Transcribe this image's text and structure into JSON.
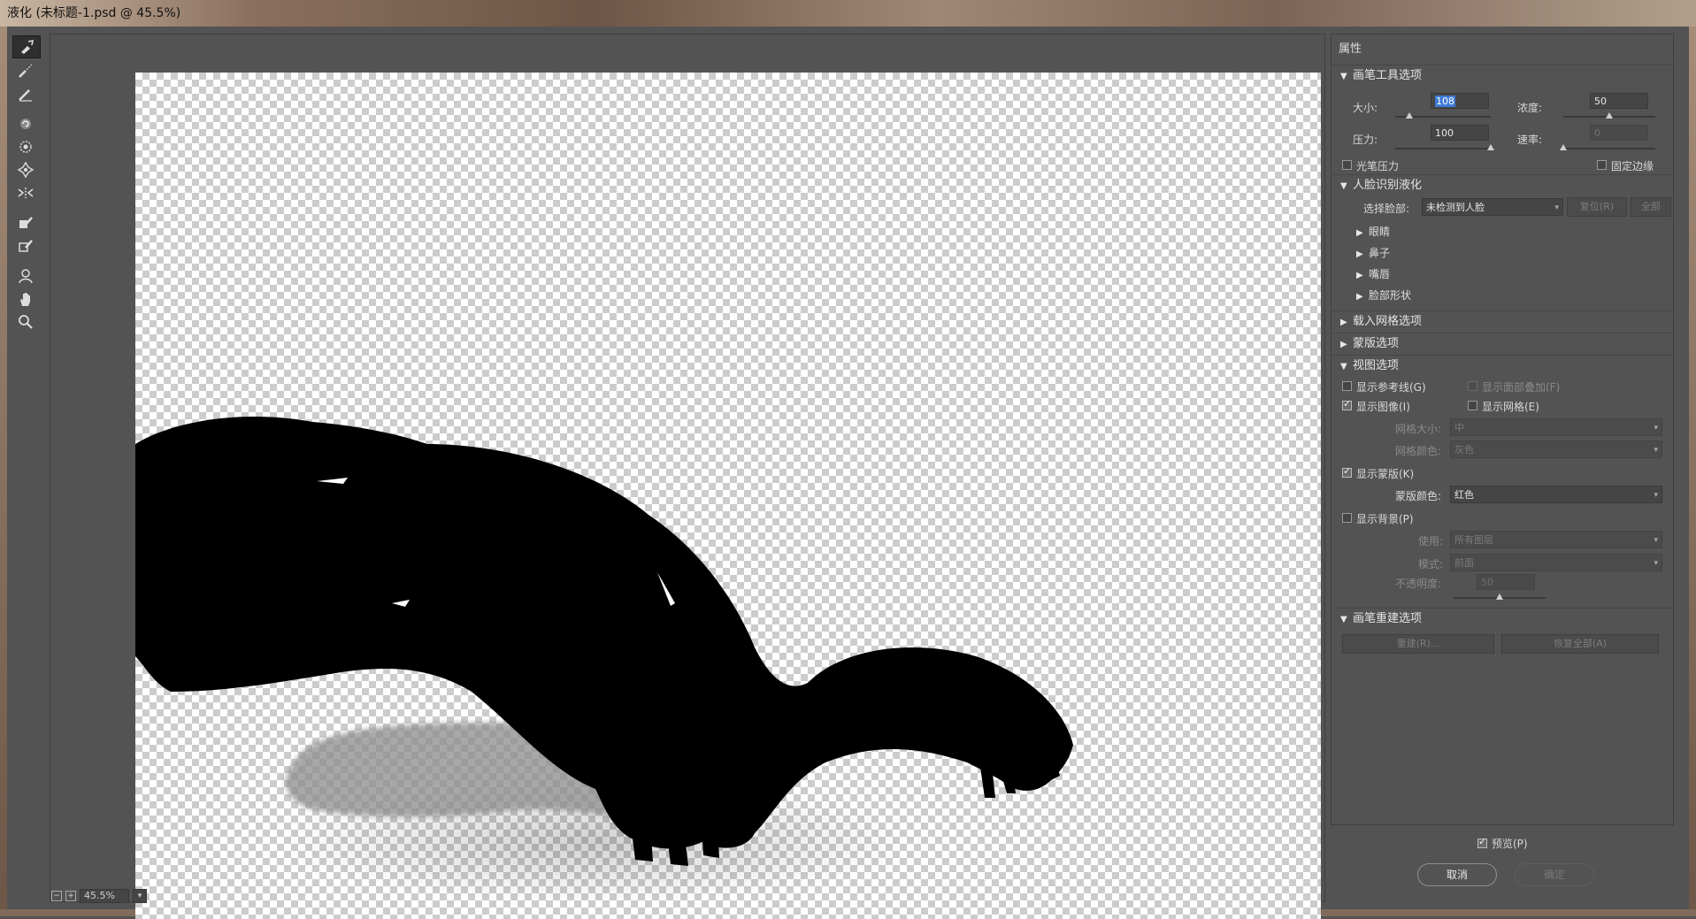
{
  "window": {
    "title": "液化 (未标题-1.psd @ 45.5%)"
  },
  "status": {
    "zoom": "45.5%"
  },
  "tools": [
    {
      "icon": "forward-warp-tool-icon"
    },
    {
      "icon": "reconstruct-tool-icon"
    },
    {
      "icon": "smooth-tool-icon"
    },
    {
      "icon": "twirl-clockwise-tool-icon"
    },
    {
      "icon": "pucker-tool-icon"
    },
    {
      "icon": "bloat-tool-icon"
    },
    {
      "icon": "push-left-tool-icon"
    },
    {
      "icon": "freeze-mask-tool-icon"
    },
    {
      "icon": "thaw-mask-tool-icon"
    },
    {
      "icon": "face-tool-icon"
    },
    {
      "icon": "hand-tool-icon"
    },
    {
      "icon": "zoom-tool-icon"
    }
  ],
  "panel": {
    "title": "属性",
    "brush": {
      "header": "画笔工具选项",
      "size_label": "大小:",
      "size_value": "108",
      "size_fraction": 0.12,
      "density_label": "浓度:",
      "density_value": "50",
      "density_fraction": 0.5,
      "pressure_label": "压力:",
      "pressure_value": "100",
      "pressure_fraction": 1.0,
      "rate_label": "速率:",
      "rate_value": "0",
      "rate_fraction": 0.0,
      "stylus_label": "光笔压力",
      "stylus_checked": false,
      "pin_edges_label": "固定边缘",
      "pin_edges_checked": false
    },
    "face": {
      "header": "人脸识别液化",
      "select_face_label": "选择脸部:",
      "select_face_value": "未检测到人脸",
      "reset_label": "复位(R)",
      "all_label": "全部",
      "items": [
        "眼睛",
        "鼻子",
        "嘴唇",
        "脸部形状"
      ]
    },
    "load_mesh_header": "载入网格选项",
    "mask_header": "蒙版选项",
    "view": {
      "header": "视图选项",
      "show_guides_label": "显示参考线(G)",
      "show_guides_checked": false,
      "show_face_overlay_label": "显示面部叠加(F)",
      "show_face_overlay_checked": false,
      "show_image_label": "显示图像(I)",
      "show_image_checked": true,
      "show_mesh_label": "显示网格(E)",
      "show_mesh_checked": false,
      "mesh_size_label": "网格大小:",
      "mesh_size_value": "中",
      "mesh_color_label": "网格颜色:",
      "mesh_color_value": "灰色",
      "show_mask_label": "显示蒙版(K)",
      "show_mask_checked": true,
      "mask_color_label": "蒙版颜色:",
      "mask_color_value": "红色",
      "show_backdrop_label": "显示背景(P)",
      "show_backdrop_checked": false,
      "use_label": "使用:",
      "use_value": "所有图层",
      "mode_label": "模式:",
      "mode_value": "前面",
      "opacity_label": "不透明度:",
      "opacity_value": "50",
      "opacity_fraction": 0.5
    },
    "reconstruct": {
      "header": "画笔重建选项",
      "reconstruct_label": "重建(R)...",
      "restore_all_label": "恢复全部(A)"
    },
    "preview_label": "预览(P)",
    "preview_checked": true,
    "cancel_label": "取消",
    "ok_label": "确定"
  }
}
